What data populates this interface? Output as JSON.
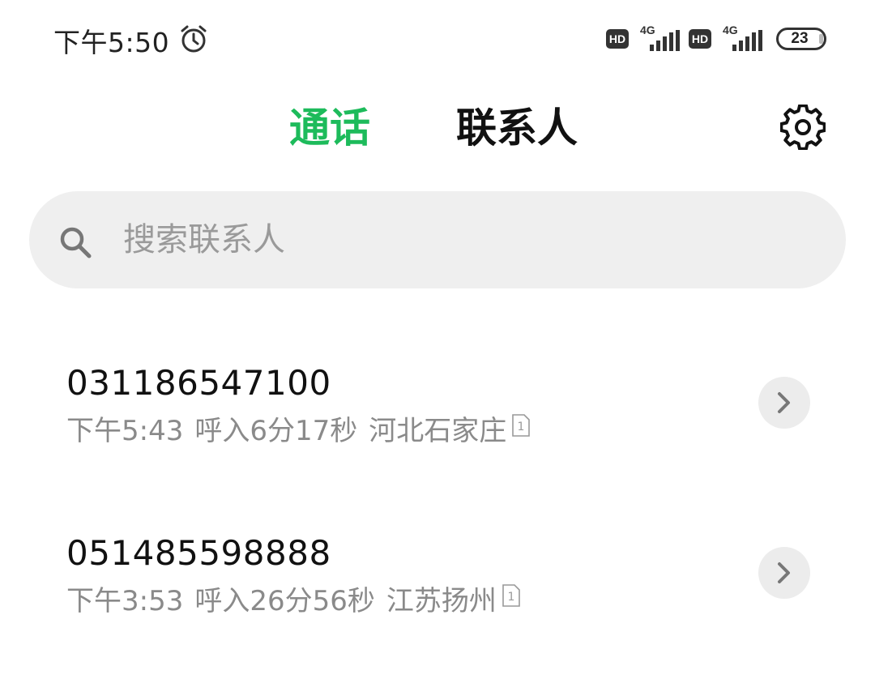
{
  "status_bar": {
    "time": "下午5:50",
    "alarm_icon": "alarm-clock-icon",
    "sim1": {
      "hd": "HD",
      "network": "4G"
    },
    "sim2": {
      "hd": "HD",
      "network": "4G"
    },
    "battery_level": "23"
  },
  "tabs": [
    {
      "label": "通话",
      "active": true
    },
    {
      "label": "联系人",
      "active": false
    }
  ],
  "settings_icon": "gear-icon",
  "search": {
    "placeholder": "搜索联系人",
    "value": ""
  },
  "calls": [
    {
      "number": "031186547100",
      "time": "下午5:43",
      "type_duration": "呼入6分17秒",
      "location": "河北石家庄",
      "sim": "1"
    },
    {
      "number": "051485598888",
      "time": "下午3:53",
      "type_duration": "呼入26分56秒",
      "location": "江苏扬州",
      "sim": "1"
    }
  ],
  "colors": {
    "accent": "#1dbb5b",
    "meta_text": "#8a8a8a",
    "search_bg": "#efefef"
  }
}
